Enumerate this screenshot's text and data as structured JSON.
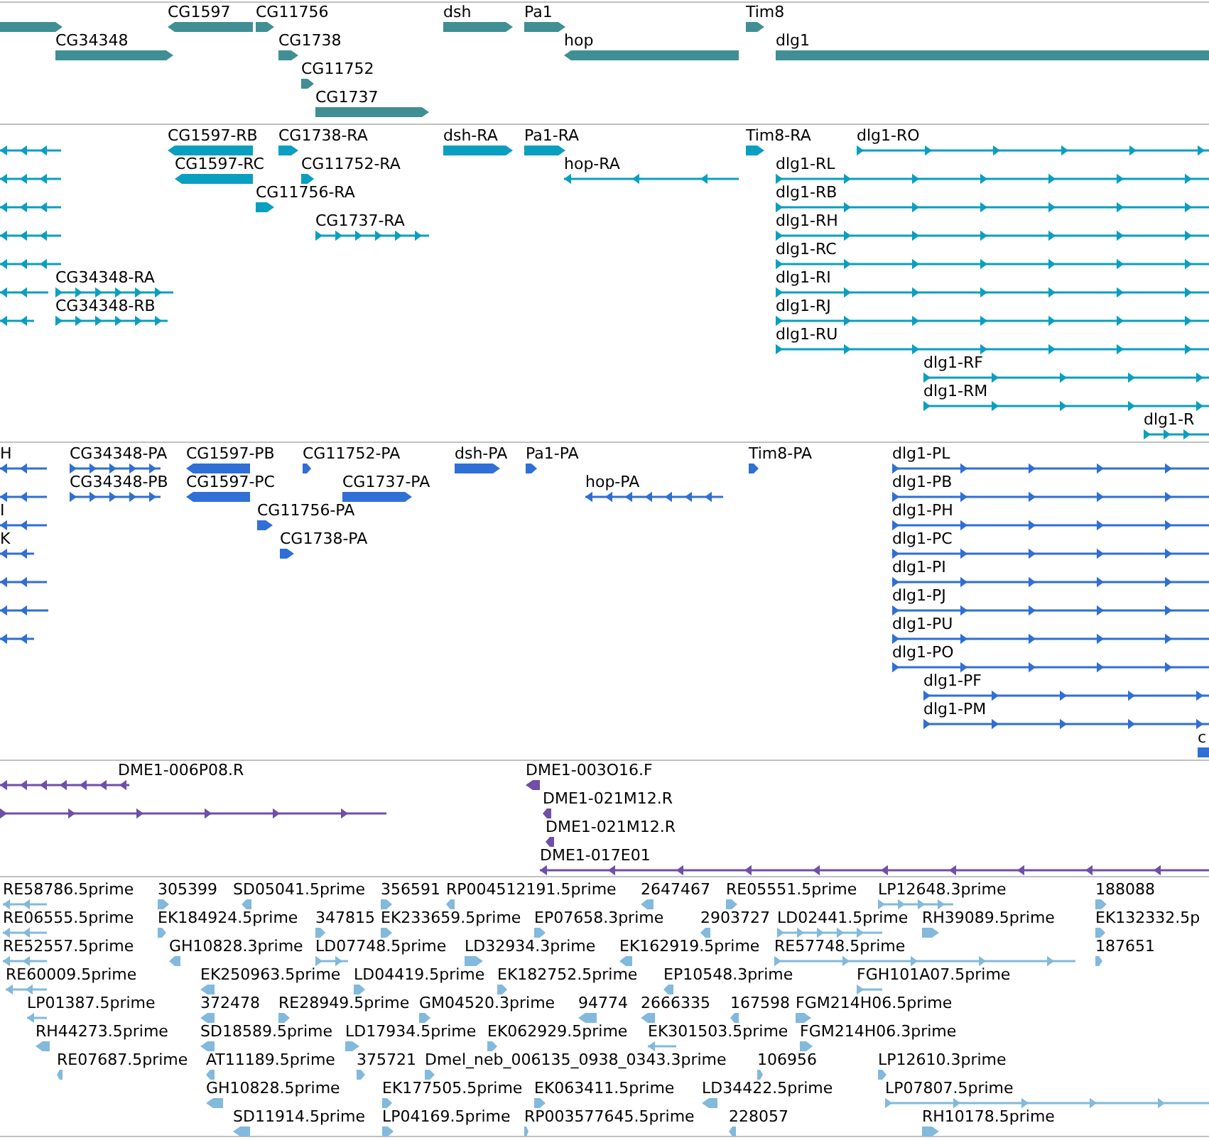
{
  "tracks": [
    {
      "color": "#3f8f94",
      "features": [
        {
          "reverse": false,
          "kind": "block"
        },
        {
          "label": "CG1597",
          "reverse": true,
          "kind": "block"
        },
        {
          "label": "CG11756",
          "reverse": false,
          "kind": "block"
        },
        {
          "label": "dsh",
          "reverse": false,
          "kind": "block"
        },
        {
          "label": "Pa1",
          "reverse": false,
          "kind": "block"
        },
        {
          "label": "Tim8",
          "reverse": false,
          "kind": "block"
        },
        {
          "label": "CG34348",
          "reverse": false,
          "kind": "block"
        },
        {
          "label": "CG1738",
          "reverse": false,
          "kind": "block"
        },
        {
          "label": "hop",
          "reverse": true,
          "kind": "block"
        },
        {
          "label": "dlg1",
          "reverse": false,
          "kind": "block"
        },
        {
          "label": "CG11752",
          "reverse": false,
          "kind": "block"
        },
        {
          "label": "CG1737",
          "reverse": false,
          "kind": "block"
        }
      ]
    },
    {
      "color": "#0a9fc0",
      "features": [
        {
          "reverse": true,
          "kind": "spliced"
        },
        {
          "label": "CG1597-RB",
          "reverse": true,
          "kind": "block"
        },
        {
          "label": "CG1738-RA",
          "reverse": false,
          "kind": "block"
        },
        {
          "label": "dsh-RA",
          "reverse": false,
          "kind": "block"
        },
        {
          "label": "Pa1-RA",
          "reverse": false,
          "kind": "block"
        },
        {
          "label": "Tim8-RA",
          "reverse": false,
          "kind": "block"
        },
        {
          "label": "dlg1-RO",
          "reverse": false,
          "kind": "spliced"
        },
        {
          "reverse": true,
          "kind": "spliced"
        },
        {
          "label": "CG1597-RC",
          "reverse": true,
          "kind": "block"
        },
        {
          "label": "CG11752-RA",
          "reverse": false,
          "kind": "block"
        },
        {
          "label": "hop-RA",
          "reverse": true,
          "kind": "spliced"
        },
        {
          "label": "dlg1-RL",
          "reverse": false,
          "kind": "spliced"
        },
        {
          "reverse": true,
          "kind": "spliced"
        },
        {
          "label": "CG11756-RA",
          "reverse": false,
          "kind": "block"
        },
        {
          "label": "dlg1-RB",
          "reverse": false,
          "kind": "spliced"
        },
        {
          "reverse": true,
          "kind": "spliced"
        },
        {
          "label": "CG1737-RA",
          "reverse": false,
          "kind": "spliced"
        },
        {
          "label": "dlg1-RH",
          "reverse": false,
          "kind": "spliced"
        },
        {
          "reverse": true,
          "kind": "spliced"
        },
        {
          "label": "dlg1-RC",
          "reverse": false,
          "kind": "spliced"
        },
        {
          "reverse": true,
          "kind": "spliced"
        },
        {
          "label": "CG34348-RA",
          "reverse": false,
          "kind": "spliced"
        },
        {
          "label": "dlg1-RI",
          "reverse": false,
          "kind": "spliced"
        },
        {
          "reverse": true,
          "kind": "spliced"
        },
        {
          "label": "CG34348-RB",
          "reverse": false,
          "kind": "spliced"
        },
        {
          "label": "dlg1-RJ",
          "reverse": false,
          "kind": "spliced"
        },
        {
          "label": "dlg1-RU",
          "reverse": false,
          "kind": "spliced"
        },
        {
          "label": "dlg1-RF",
          "reverse": false,
          "kind": "spliced"
        },
        {
          "label": "dlg1-RM",
          "reverse": false,
          "kind": "spliced"
        },
        {
          "label": "dlg1-R",
          "reverse": false,
          "kind": "spliced"
        }
      ]
    },
    {
      "color": "#2f6fd6",
      "features": [
        {
          "label": "H",
          "reverse": true,
          "kind": "spliced"
        },
        {
          "label": "CG34348-PA",
          "reverse": false,
          "kind": "spliced"
        },
        {
          "label": "CG1597-PB",
          "reverse": true,
          "kind": "block"
        },
        {
          "label": "CG11752-PA",
          "reverse": false,
          "kind": "block"
        },
        {
          "label": "dsh-PA",
          "reverse": false,
          "kind": "block"
        },
        {
          "label": "Pa1-PA",
          "reverse": false,
          "kind": "block"
        },
        {
          "label": "Tim8-PA",
          "reverse": false,
          "kind": "block"
        },
        {
          "label": "dlg1-PL",
          "reverse": false,
          "kind": "spliced"
        },
        {
          "reverse": true,
          "kind": "spliced"
        },
        {
          "label": "CG34348-PB",
          "reverse": false,
          "kind": "spliced"
        },
        {
          "label": "CG1597-PC",
          "reverse": true,
          "kind": "block"
        },
        {
          "label": "CG1737-PA",
          "reverse": false,
          "kind": "block"
        },
        {
          "label": "hop-PA",
          "reverse": true,
          "kind": "spliced"
        },
        {
          "label": "dlg1-PB",
          "reverse": false,
          "kind": "spliced"
        },
        {
          "label": "I",
          "reverse": true,
          "kind": "spliced"
        },
        {
          "label": "CG11756-PA",
          "reverse": false,
          "kind": "block"
        },
        {
          "label": "dlg1-PH",
          "reverse": false,
          "kind": "spliced"
        },
        {
          "label": "K",
          "reverse": true,
          "kind": "spliced"
        },
        {
          "label": "CG1738-PA",
          "reverse": false,
          "kind": "block"
        },
        {
          "label": "dlg1-PC",
          "reverse": false,
          "kind": "spliced"
        },
        {
          "reverse": true,
          "kind": "spliced"
        },
        {
          "label": "dlg1-PI",
          "reverse": false,
          "kind": "spliced"
        },
        {
          "reverse": true,
          "kind": "spliced"
        },
        {
          "label": "dlg1-PJ",
          "reverse": false,
          "kind": "spliced"
        },
        {
          "reverse": true,
          "kind": "spliced"
        },
        {
          "label": "dlg1-PU",
          "reverse": false,
          "kind": "spliced"
        },
        {
          "label": "dlg1-PO",
          "reverse": false,
          "kind": "spliced"
        },
        {
          "label": "dlg1-PF",
          "reverse": false,
          "kind": "spliced"
        },
        {
          "label": "dlg1-PM",
          "reverse": false,
          "kind": "spliced"
        },
        {
          "label": "c",
          "reverse": false,
          "kind": "block"
        }
      ]
    },
    {
      "color": "#6f4fa8",
      "features": [
        {
          "label": "DME1-006P08.R",
          "reverse": true,
          "kind": "spliced"
        },
        {
          "label": "DME1-003O16.F",
          "reverse": true,
          "kind": "block"
        },
        {
          "reverse": false,
          "kind": "spliced"
        },
        {
          "label": "DME1-021M12.R",
          "reverse": true,
          "kind": "block"
        },
        {
          "label": "DME1-021M12.R",
          "reverse": true,
          "kind": "block"
        },
        {
          "label": "DME1-017E01",
          "reverse": true,
          "kind": "spliced"
        }
      ]
    },
    {
      "color": "#82b9dc",
      "features": [
        {
          "label": "RE58786.5prime",
          "reverse": true,
          "kind": "spliced"
        },
        {
          "label": "305399",
          "reverse": false,
          "kind": "block"
        },
        {
          "label": "SD05041.5prime",
          "reverse": true,
          "kind": "block"
        },
        {
          "label": "356591",
          "reverse": false,
          "kind": "block"
        },
        {
          "label": "RP004512191.5prime",
          "reverse": true,
          "kind": "block"
        },
        {
          "label": "2647467",
          "reverse": true,
          "kind": "block"
        },
        {
          "label": "RE05551.5prime",
          "reverse": false,
          "kind": "block"
        },
        {
          "label": "LP12648.3prime",
          "reverse": false,
          "kind": "spliced"
        },
        {
          "label": "188088",
          "reverse": false,
          "kind": "block"
        },
        {
          "label": "RE06555.5prime",
          "reverse": true,
          "kind": "spliced"
        },
        {
          "label": "EK184924.5prime",
          "reverse": false,
          "kind": "block"
        },
        {
          "label": "347815",
          "reverse": false,
          "kind": "block"
        },
        {
          "label": "EK233659.5prime",
          "reverse": false,
          "kind": "block"
        },
        {
          "label": "EP07658.3prime",
          "reverse": false,
          "kind": "block"
        },
        {
          "label": "2903727",
          "reverse": true,
          "kind": "block"
        },
        {
          "label": "LD02441.5prime",
          "reverse": false,
          "kind": "spliced"
        },
        {
          "label": "RH39089.5prime",
          "reverse": false,
          "kind": "block"
        },
        {
          "label": "EK132332.5p",
          "reverse": false,
          "kind": "block"
        },
        {
          "label": "RE52557.5prime",
          "reverse": true,
          "kind": "spliced"
        },
        {
          "label": "GH10828.3prime",
          "reverse": true,
          "kind": "block"
        },
        {
          "label": "LD07748.5prime",
          "reverse": false,
          "kind": "spliced"
        },
        {
          "label": "LD32934.3prime",
          "reverse": false,
          "kind": "block"
        },
        {
          "label": "EK162919.5prime",
          "reverse": true,
          "kind": "block"
        },
        {
          "label": "RE57748.5prime",
          "reverse": false,
          "kind": "spliced"
        },
        {
          "label": "187651",
          "reverse": false,
          "kind": "block"
        },
        {
          "label": "RE60009.5prime",
          "reverse": true,
          "kind": "spliced"
        },
        {
          "label": "EK250963.5prime",
          "reverse": true,
          "kind": "block"
        },
        {
          "label": "LD04419.5prime",
          "reverse": false,
          "kind": "block"
        },
        {
          "label": "EK182752.5prime",
          "reverse": false,
          "kind": "block"
        },
        {
          "label": "EP10548.3prime",
          "reverse": true,
          "kind": "block"
        },
        {
          "label": "FGH101A07.5prime",
          "reverse": false,
          "kind": "spliced"
        },
        {
          "label": "LP01387.5prime",
          "reverse": true,
          "kind": "spliced"
        },
        {
          "label": "372478",
          "reverse": true,
          "kind": "block"
        },
        {
          "label": "RE28949.5prime",
          "reverse": false,
          "kind": "block"
        },
        {
          "label": "GM04520.3prime",
          "reverse": false,
          "kind": "block"
        },
        {
          "label": "94774",
          "reverse": true,
          "kind": "block"
        },
        {
          "label": "2666335",
          "reverse": true,
          "kind": "block"
        },
        {
          "label": "167598",
          "reverse": true,
          "kind": "block"
        },
        {
          "label": "FGM214H06.5prime",
          "reverse": false,
          "kind": "block"
        },
        {
          "label": "RH44273.5prime",
          "reverse": true,
          "kind": "block"
        },
        {
          "label": "SD18589.5prime",
          "reverse": true,
          "kind": "block"
        },
        {
          "label": "LD17934.5prime",
          "reverse": false,
          "kind": "block"
        },
        {
          "label": "EK062929.5prime",
          "reverse": false,
          "kind": "block"
        },
        {
          "label": "EK301503.5prime",
          "reverse": true,
          "kind": "spliced"
        },
        {
          "label": "FGM214H06.3prime",
          "reverse": false,
          "kind": "block"
        },
        {
          "label": "RE07687.5prime",
          "reverse": true,
          "kind": "block"
        },
        {
          "label": "AT11189.5prime",
          "reverse": true,
          "kind": "block"
        },
        {
          "label": "375721",
          "reverse": false,
          "kind": "block"
        },
        {
          "label": "Dmel_neb_006135_0938_0343.3prime",
          "reverse": false,
          "kind": "block"
        },
        {
          "label": "106956",
          "reverse": false,
          "kind": "block"
        },
        {
          "label": "LP12610.3prime",
          "reverse": false,
          "kind": "block"
        },
        {
          "label": "GH10828.5prime",
          "reverse": true,
          "kind": "block"
        },
        {
          "label": "EK177505.5prime",
          "reverse": false,
          "kind": "block"
        },
        {
          "label": "EK063411.5prime",
          "reverse": false,
          "kind": "block"
        },
        {
          "label": "LD34422.5prime",
          "reverse": true,
          "kind": "block"
        },
        {
          "label": "LP07807.5prime",
          "reverse": false,
          "kind": "spliced"
        },
        {
          "label": "SD11914.5prime",
          "reverse": true,
          "kind": "block"
        },
        {
          "label": "LP04169.5prime",
          "reverse": false,
          "kind": "block"
        },
        {
          "label": "RP003577645.5prime",
          "reverse": false,
          "kind": "block"
        },
        {
          "label": "228057",
          "reverse": true,
          "kind": "block"
        },
        {
          "label": "RH10178.5prime",
          "reverse": false,
          "kind": "block"
        }
      ]
    }
  ]
}
